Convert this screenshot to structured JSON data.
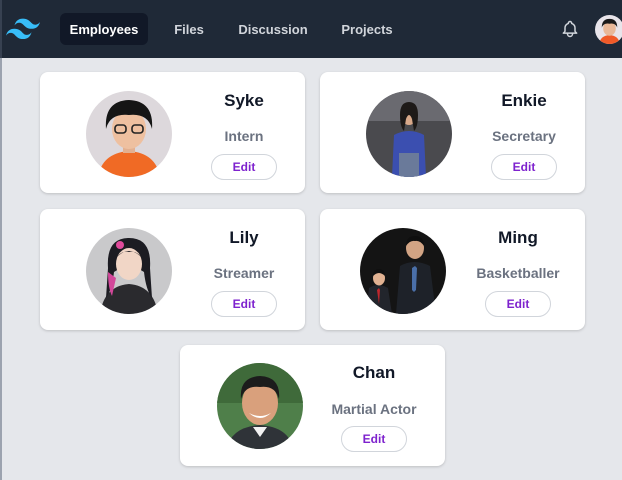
{
  "header": {
    "logo": "tailwind-logo",
    "nav": [
      {
        "label": "Employees",
        "active": true
      },
      {
        "label": "Files",
        "active": false
      },
      {
        "label": "Discussion",
        "active": false
      },
      {
        "label": "Projects",
        "active": false
      }
    ],
    "bell_icon": "bell-icon",
    "accent": "#38bdf8"
  },
  "employees": [
    {
      "name": "Syke",
      "role": "Intern",
      "edit": "Edit"
    },
    {
      "name": "Enkie",
      "role": "Secretary",
      "edit": "Edit"
    },
    {
      "name": "Lily",
      "role": "Streamer",
      "edit": "Edit"
    },
    {
      "name": "Ming",
      "role": "Basketballer",
      "edit": "Edit"
    },
    {
      "name": "Chan",
      "role": "Martial Actor",
      "edit": "Edit"
    }
  ],
  "colors": {
    "topbar": "#1f2937",
    "active_tab": "#111827",
    "background": "#e5e7eb",
    "edit_text": "#7e22ce",
    "role_text": "#6b7280"
  }
}
